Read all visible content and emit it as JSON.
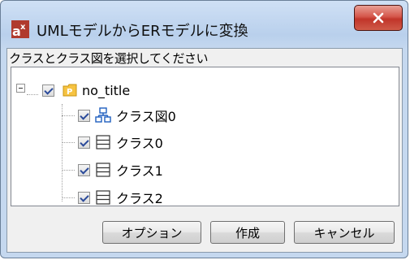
{
  "window": {
    "title": "UMLモデルからERモデルに変換"
  },
  "instruction": "クラスとクラス図を選択してください",
  "tree": {
    "root": {
      "label": "no_title",
      "checked": true
    },
    "children": [
      {
        "label": "クラス図0",
        "checked": true,
        "icon": "class-diagram-icon"
      },
      {
        "label": "クラス0",
        "checked": true,
        "icon": "class-icon"
      },
      {
        "label": "クラス1",
        "checked": true,
        "icon": "class-icon"
      },
      {
        "label": "クラス2",
        "checked": true,
        "icon": "class-icon"
      }
    ]
  },
  "buttons": {
    "options": "オプション",
    "create": "作成",
    "cancel": "キャンセル"
  }
}
